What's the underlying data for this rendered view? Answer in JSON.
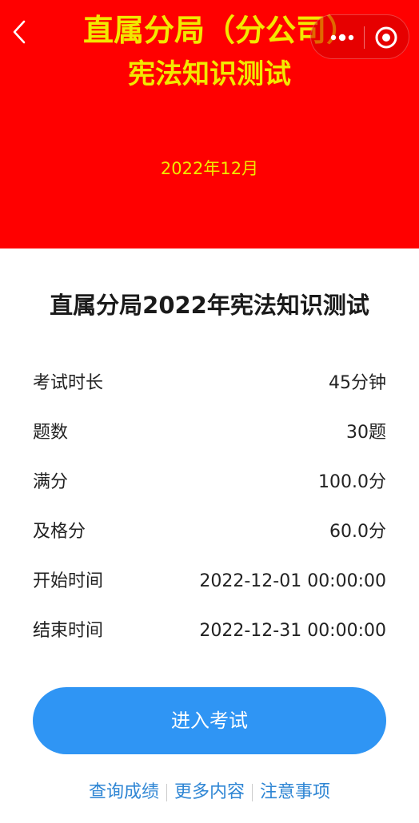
{
  "banner": {
    "title_line1": "直属分局（分公司）",
    "title_line2": "宪法知识测试",
    "date": "2022年12月",
    "background_color": "#ff0000",
    "text_color": "#f2e800"
  },
  "nav": {
    "back_icon": "chevron-left-icon",
    "more_icon": "more-dots-icon",
    "close_icon": "target-circle-icon"
  },
  "exam": {
    "title": "直属分局2022年宪法知识测试",
    "rows": [
      {
        "label": "考试时长",
        "value": "45分钟"
      },
      {
        "label": "题数",
        "value": "30题"
      },
      {
        "label": "满分",
        "value": "100.0分"
      },
      {
        "label": "及格分",
        "value": "60.0分"
      },
      {
        "label": "开始时间",
        "value": "2022-12-01 00:00:00"
      },
      {
        "label": "结束时间",
        "value": "2022-12-31 00:00:00"
      }
    ]
  },
  "actions": {
    "enter_label": "进入考试",
    "button_color": "#2f95f4"
  },
  "footer": {
    "links": [
      "查询成绩",
      "更多内容",
      "注意事项"
    ],
    "link_color": "#2f86d4"
  }
}
